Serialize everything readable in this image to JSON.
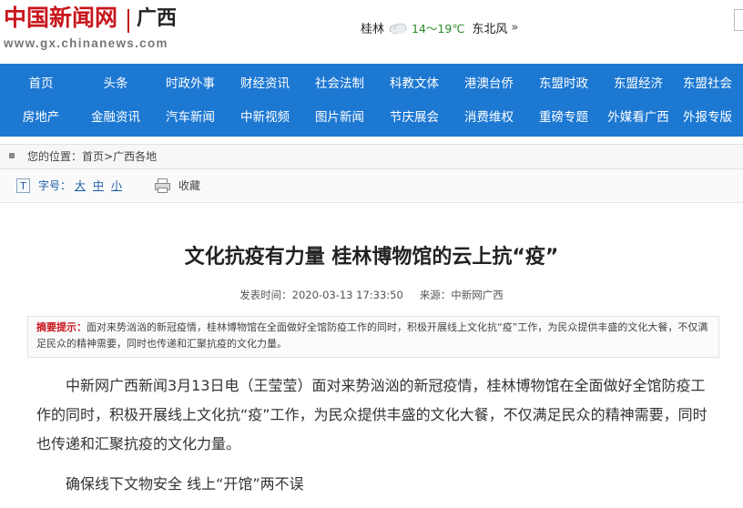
{
  "header": {
    "logo_cn": "中国新闻网",
    "region": "广西",
    "url": "www.gx.chinanews.com"
  },
  "weather": {
    "city": "桂林",
    "temp": "14～19℃",
    "wind": "东北风",
    "more": "»",
    "icon": "cloud-icon"
  },
  "nav": {
    "row1": [
      "首页",
      "头条",
      "时政外事",
      "财经资讯",
      "社会法制",
      "科教文体",
      "港澳台侨",
      "东盟时政",
      "东盟经济",
      "东盟社会"
    ],
    "row2": [
      "房地产",
      "金融资讯",
      "汽车新闻",
      "中新视频",
      "图片新闻",
      "节庆展会",
      "消费维权",
      "重磅专题",
      "外媒看广西",
      "外报专版"
    ]
  },
  "breadcrumb": {
    "prefix": "您的位置：",
    "home": "首页",
    "sep": ">",
    "section": "广西各地"
  },
  "toolbar": {
    "font_label": "字号：",
    "sizes": [
      "大",
      "中",
      "小"
    ],
    "favorite": "收藏"
  },
  "article": {
    "title": "文化抗疫有力量 桂林博物馆的云上抗“疫”",
    "published": "发表时间：2020-03-13 17:33:50",
    "source": "来源：中新网广西",
    "summary_label": "摘要提示：",
    "summary": "面对来势汹汹的新冠疫情，桂林博物馆在全面做好全馆防疫工作的同时，积极开展线上文化抗“疫”工作，为民众提供丰盛的文化大餐，不仅满足民众的精神需要，同时也传递和汇聚抗疫的文化力量。",
    "paragraph1": "中新网广西新闻3月13日电（王莹莹）面对来势汹汹的新冠疫情，桂林博物馆在全面做好全馆防疫工作的同时，积极开展线上文化抗“疫”工作，为民众提供丰盛的文化大餐，不仅满足民众的精神需要，同时也传递和汇聚抗疫的文化力量。",
    "subheading": "确保线下文物安全 线上“开馆”两不误"
  },
  "colors": {
    "brand_red": "#c8161d",
    "nav_blue": "#1d78d2",
    "link_blue": "#1d5ea8"
  }
}
